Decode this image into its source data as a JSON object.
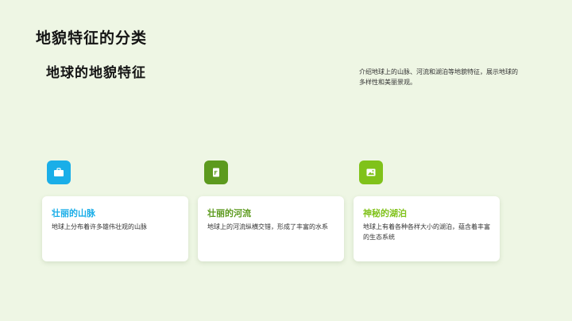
{
  "slide": {
    "title": "地貌特征的分类",
    "subtitle": "地球的地貌特征",
    "description": "介绍地球上的山脉、河流和湖泊等地貌特征，展示地球的多样性和美丽景观。"
  },
  "cards": [
    {
      "icon": "briefcase-icon",
      "color": "#1aaee8",
      "title": "壮丽的山脉",
      "text": "地球上分布着许多雄伟壮观的山脉"
    },
    {
      "icon": "document-icon",
      "color": "#5c9a1e",
      "title": "壮丽的河流",
      "text": "地球上的河流纵横交错，形成了丰富的水系"
    },
    {
      "icon": "image-icon",
      "color": "#80c21a",
      "title": "神秘的湖泊",
      "text": "地球上有着各种各样大小的湖泊，蕴含着丰富的生态系统"
    }
  ]
}
